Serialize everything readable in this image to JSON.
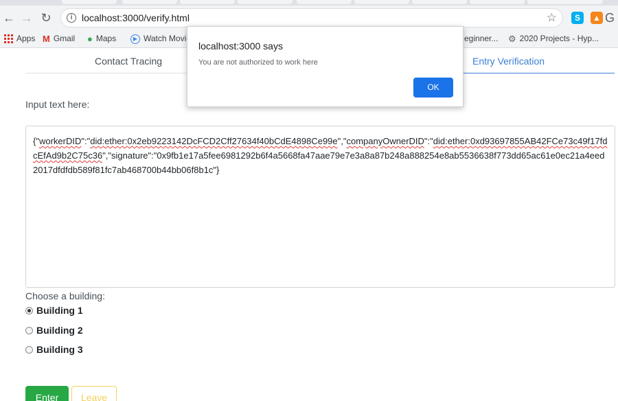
{
  "browser": {
    "url": "localhost:3000/verify.html"
  },
  "bookmarks": [
    {
      "label": "Apps",
      "icon": "apps-grid-icon"
    },
    {
      "label": "Gmail",
      "icon": "gmail-icon"
    },
    {
      "label": "Maps",
      "icon": "maps-pin-icon"
    },
    {
      "label": "Watch Movie",
      "icon": "play-icon"
    },
    {
      "label": "eginner...",
      "icon": ""
    },
    {
      "label": "2020 Projects - Hyp...",
      "icon": "gear-icon"
    }
  ],
  "nav": {
    "tabs": [
      {
        "label": "Contact Tracing",
        "active": false
      },
      {
        "label": "Entry Verification",
        "active": true
      }
    ],
    "accent_color": "#3b7fd4"
  },
  "form": {
    "input_label": "Input text here:",
    "text_parts": [
      "{\"",
      "workerDID",
      "\":\"",
      "did:ether:0x2eb9223142DcFCD2Cff27634f40bCdE4898Ce99e",
      "\",\"",
      "companyOwnerDID",
      "\":\"",
      "did:ether:0xd93697855AB42FCe73c49f17fdcEfAd9b2C75c36",
      "\",\"signature\":\"0x9fb1e17a5fee6981292b6f4a5668fa47aae79e7e3a8a87b248a888254e8ab5536638f773dd65ac61e0ec21a4eed2017dfdfdb589f81fc7ab468700b44bb06f8b1c\"}"
    ],
    "building_label": "Choose a building:",
    "buildings": [
      {
        "label": "Building 1",
        "checked": true
      },
      {
        "label": "Building 2",
        "checked": false
      },
      {
        "label": "Building 3",
        "checked": false
      }
    ],
    "enter_label": "Enter",
    "leave_label": "Leave",
    "enter_color": "#28a745",
    "leave_color": "#f3d15c"
  },
  "dialog": {
    "title": "localhost:3000 says",
    "message": "You are not authorized to work here",
    "ok_label": "OK",
    "ok_color": "#1a73e8"
  }
}
